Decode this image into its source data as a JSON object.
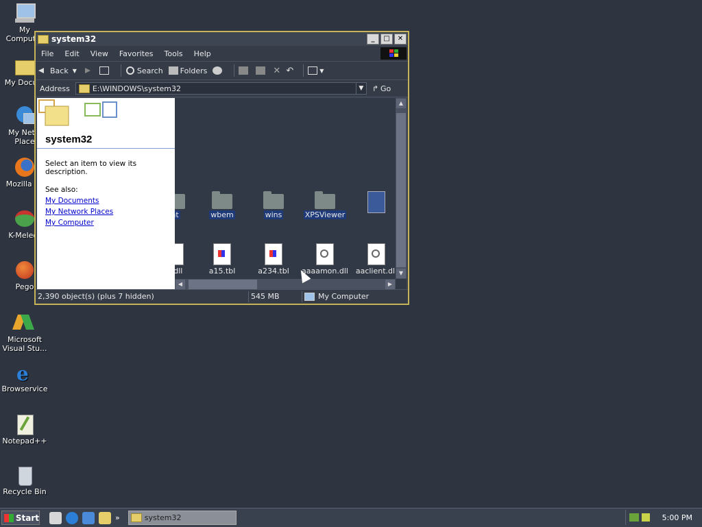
{
  "desktop": {
    "icons": [
      {
        "label": "My Computer",
        "icon": "my-computer-icon"
      },
      {
        "label": "My Docum",
        "icon": "my-documents-icon"
      },
      {
        "label": "My Netw Place",
        "icon": "network-places-icon"
      },
      {
        "label": "Mozilla Fir",
        "icon": "firefox-icon"
      },
      {
        "label": "K-Meleor",
        "icon": "kmeleon-icon"
      },
      {
        "label": "Pego",
        "icon": "pego-icon"
      },
      {
        "label": "Microsoft Visual Stu...",
        "icon": "visual-studio-icon"
      },
      {
        "label": "Browservice",
        "icon": "ie-icon"
      },
      {
        "label": "Notepad++",
        "icon": "notepadpp-icon"
      },
      {
        "label": "Recycle Bin",
        "icon": "recycle-bin-icon"
      }
    ]
  },
  "window": {
    "title": "system32",
    "menu": [
      "File",
      "Edit",
      "View",
      "Favorites",
      "Tools",
      "Help"
    ],
    "toolbar": {
      "back": "Back",
      "search": "Search",
      "folders": "Folders"
    },
    "address": {
      "label": "Address",
      "value": "E:\\WINDOWS\\system32",
      "go": "Go"
    },
    "left_panel": {
      "title": "system32",
      "description": "Select an item to view its description.",
      "see_also": "See also:",
      "links": [
        "My Documents",
        "My Network Places",
        "My Computer"
      ]
    },
    "folders": [
      {
        "name": "nt",
        "selected": true
      },
      {
        "name": "wbem",
        "selected": true
      },
      {
        "name": "wins",
        "selected": true
      },
      {
        "name": "XPSViewer",
        "selected": true
      }
    ],
    "files": [
      "c.dll",
      "a15.tbl",
      "a234.tbl",
      "aaaamon.dll",
      "aaclient.dll"
    ],
    "status": {
      "objects": "2,390 object(s) (plus 7 hidden)",
      "size": "545 MB",
      "location": "My Computer"
    }
  },
  "taskbar": {
    "start": "Start",
    "task": "system32",
    "more": "»",
    "clock": "5:00 PM"
  }
}
